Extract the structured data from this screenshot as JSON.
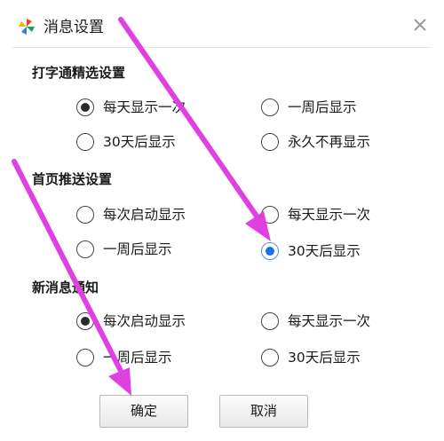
{
  "dialog": {
    "title": "消息设置",
    "icons": {
      "app": "pinwheel-logo-icon",
      "close": "close-icon"
    },
    "colors": {
      "arrow": "#e040e0",
      "selected_blue": "#1f6fe0",
      "selected_dark": "#2a2a2a"
    }
  },
  "sections": [
    {
      "title": "打字通精选设置",
      "options": [
        {
          "label": "每天显示一次",
          "selected": true
        },
        {
          "label": "一周后显示",
          "selected": false
        },
        {
          "label": "30天后显示",
          "selected": false
        },
        {
          "label": "永久不再显示",
          "selected": false
        }
      ]
    },
    {
      "title": "首页推送设置",
      "options": [
        {
          "label": "每次启动显示",
          "selected": false
        },
        {
          "label": "每天显示一次",
          "selected": false
        },
        {
          "label": "一周后显示",
          "selected": false
        },
        {
          "label": "30天后显示",
          "selected": true
        }
      ]
    },
    {
      "title": "新消息通知",
      "options": [
        {
          "label": "每次启动显示",
          "selected": true
        },
        {
          "label": "每天显示一次",
          "selected": false
        },
        {
          "label": "一周后显示",
          "selected": false
        },
        {
          "label": "30天后显示",
          "selected": false
        }
      ]
    }
  ],
  "buttons": {
    "ok_label": "确定",
    "cancel_label": "取消"
  }
}
